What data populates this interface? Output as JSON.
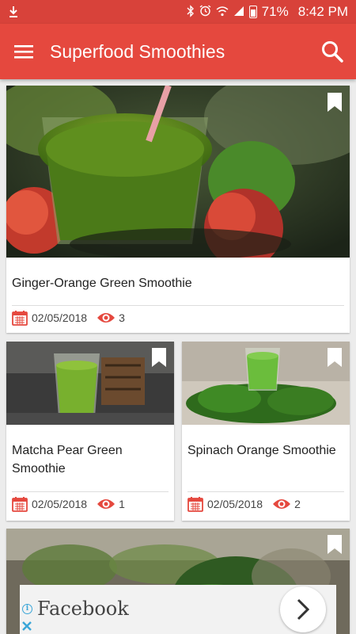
{
  "status_bar": {
    "battery": "71%",
    "time": "8:42 PM",
    "icons": [
      "download-icon",
      "bluetooth-icon",
      "alarm-icon",
      "wifi-icon",
      "signal-icon",
      "battery-icon"
    ]
  },
  "app_bar": {
    "title": "Superfood Smoothies",
    "menu_icon": "menu-icon",
    "search_icon": "search-icon"
  },
  "colors": {
    "status_bar": "#d8423a",
    "app_bar": "#e5483e",
    "accent": "#e5483e"
  },
  "recipes": [
    {
      "title": "Ginger-Orange Green Smoothie",
      "date": "02/05/2018",
      "views": "3"
    },
    {
      "title": "Matcha Pear Green Smoothie",
      "date": "02/05/2018",
      "views": "1"
    },
    {
      "title": "Spinach Orange Smoothie",
      "date": "02/05/2018",
      "views": "2"
    },
    {
      "title": "",
      "date": "",
      "views": ""
    }
  ],
  "ad": {
    "label": "Facebook",
    "info_icon": "info-icon",
    "close_icon": "close-icon",
    "arrow_icon": "chevron-right-icon"
  }
}
